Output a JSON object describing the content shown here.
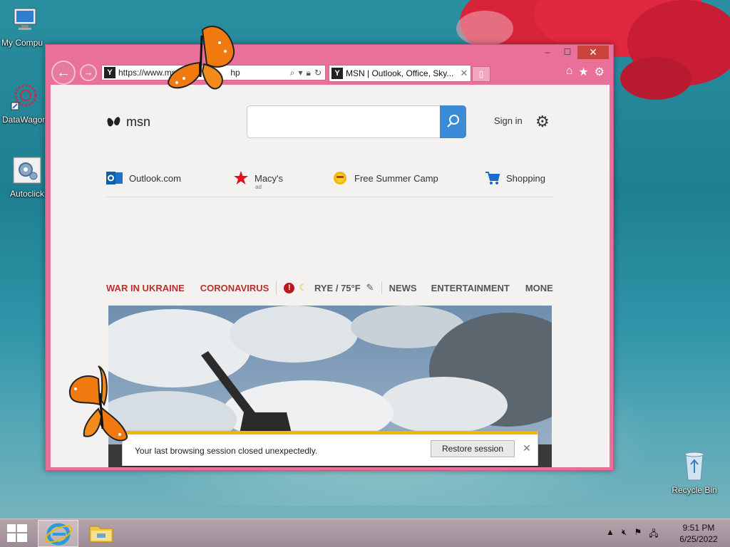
{
  "desktop": {
    "icons": [
      {
        "label": "My Compu",
        "icon": "computer-icon"
      },
      {
        "label": "DataWagon",
        "icon": "datawagon-icon"
      },
      {
        "label": "Autoclick",
        "icon": "autoclick-icon"
      },
      {
        "label": "Recycle Bin",
        "icon": "recycle-bin-icon"
      }
    ]
  },
  "browser": {
    "address": "https://www.ms",
    "address_tail": "hp",
    "tab_title": "MSN | Outlook, Office, Sky...",
    "controls": {
      "minimize": "–",
      "maximize": "☐",
      "close": "✕"
    }
  },
  "msn": {
    "logo_text": "msn",
    "signin": "Sign in",
    "quicklinks": [
      {
        "label": "Outlook.com",
        "icon": "outlook-icon"
      },
      {
        "label": "Macy's",
        "sub": "ad",
        "icon": "macys-star-icon"
      },
      {
        "label": "Free Summer Camp",
        "icon": "sun-icon"
      },
      {
        "label": "Shopping",
        "icon": "cart-icon"
      }
    ],
    "nav": {
      "war": "WAR IN UKRAINE",
      "corona": "CORONAVIRUS",
      "weather": "RYE / 75°F",
      "news": "NEWS",
      "entertainment": "ENTERTAINMENT",
      "money": "MONE"
    }
  },
  "restore_bar": {
    "message": "Your last browsing session closed unexpectedly.",
    "button": "Restore session"
  },
  "taskbar": {
    "time": "9:51 PM",
    "date": "6/25/2022"
  },
  "colors": {
    "window_frame": "#e8709a",
    "msn_accent": "#3a8ad6",
    "nav_red": "#b8322c",
    "notification_bar": "#f2b705"
  }
}
